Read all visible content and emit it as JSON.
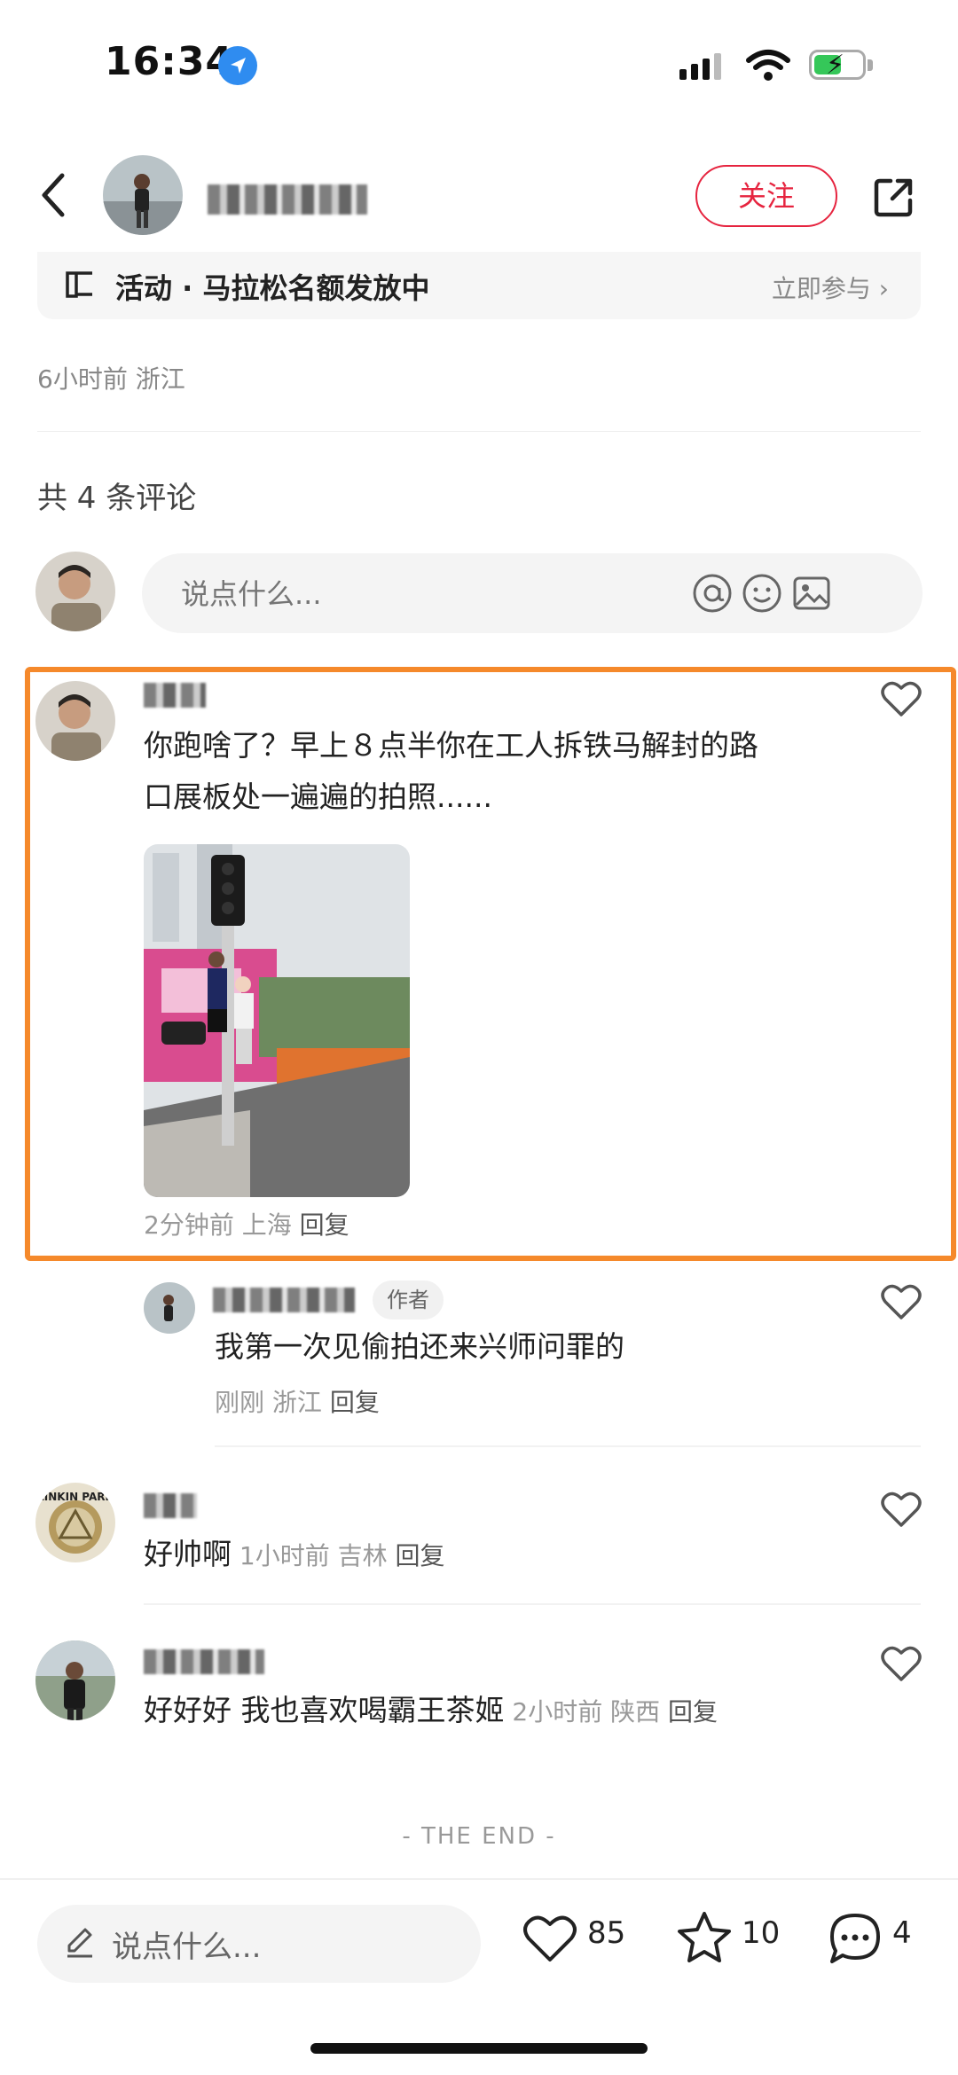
{
  "status_bar": {
    "time": "16:34"
  },
  "header": {
    "follow_label": "关注"
  },
  "activity": {
    "icon": "book-icon",
    "text": "活动 · 马拉松名额发放中",
    "cta": "立即参与 ›"
  },
  "post_meta": {
    "time_location": "6小时前 浙江"
  },
  "comments_header": {
    "count_text": "共 4 条评论"
  },
  "comment_input": {
    "placeholder": "说点什么..."
  },
  "comments": [
    {
      "text_line1": "你跑啥了？早上８点半你在工人拆铁马解封的路",
      "text_line2": "口展板处一遍遍的拍照......",
      "meta": "2分钟前 上海 ",
      "reply": "回复",
      "replies": [
        {
          "badge": "作者",
          "text": "我第一次见偷拍还来兴师问罪的",
          "meta": "刚刚 浙江 ",
          "reply": "回复"
        }
      ]
    },
    {
      "text": "好帅啊",
      "meta": " 1小时前 吉林 ",
      "reply": "回复",
      "avatar_text": "LINKIN PARK"
    },
    {
      "text": "好好好 我也喜欢喝霸王茶姬",
      "meta": " 2小时前 陕西 ",
      "reply": "回复"
    }
  ],
  "end_text": "- THE END -",
  "bottom_bar": {
    "placeholder": "说点什么...",
    "likes": "85",
    "stars": "10",
    "comments": "4"
  },
  "colors": {
    "accent": "#e6243f",
    "highlight": "#f5892b"
  }
}
